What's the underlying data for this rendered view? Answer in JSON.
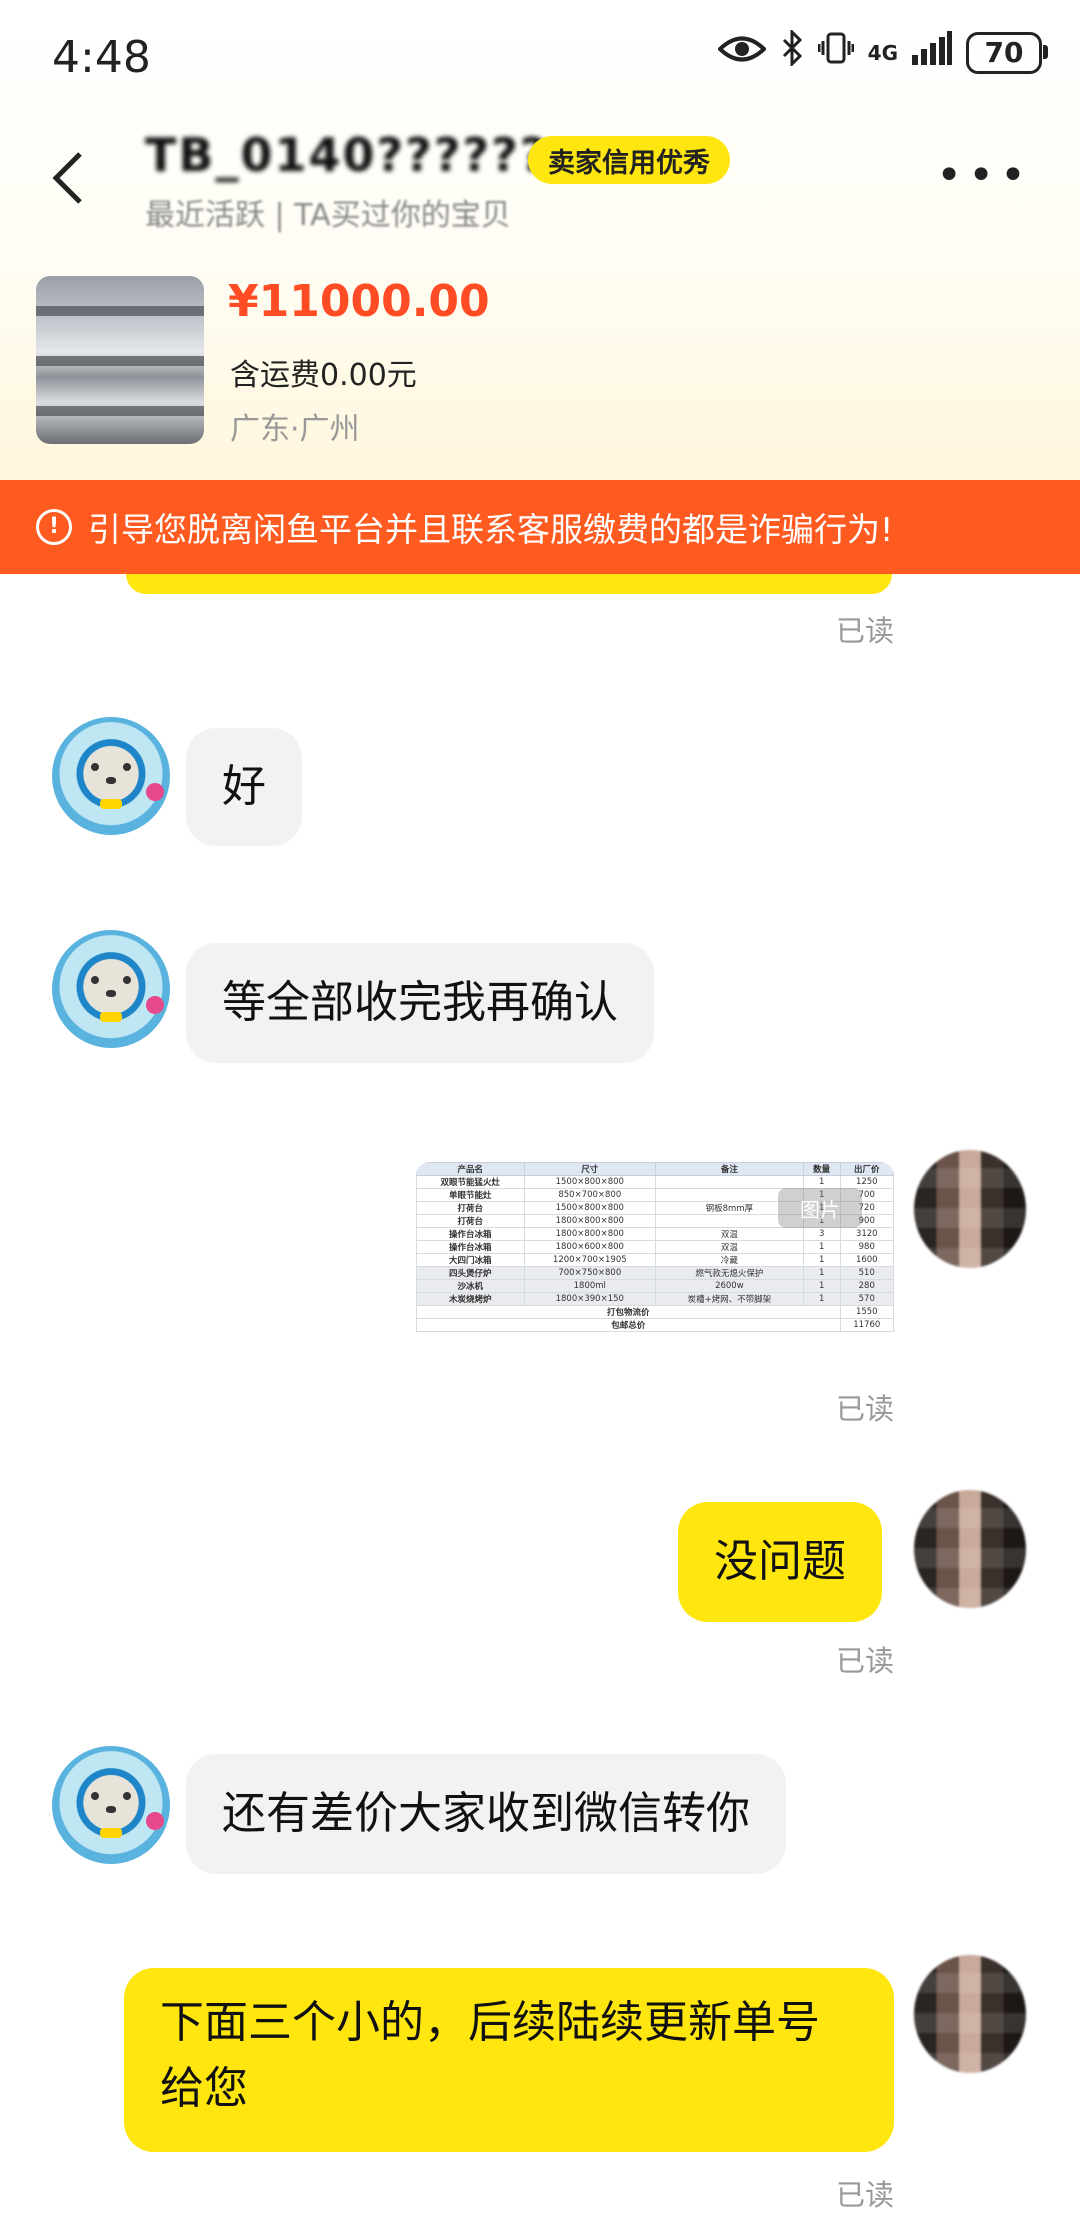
{
  "status_bar": {
    "time": "4:48",
    "network": "4G",
    "battery": "70"
  },
  "header": {
    "seller_name": "TB_0140??????",
    "badge": "卖家信用优秀",
    "subtitle": "最近活跃  |  TA买过你的宝贝"
  },
  "product": {
    "price": "¥11000.00",
    "shipping": "含运费0.00元",
    "location": "广东·广州"
  },
  "warning": {
    "text": "引导您脱离闲鱼平台并且联系客服缴费的都是诈骗行为!"
  },
  "messages": {
    "read_label": "已读",
    "m1": "好",
    "m2": "等全部收完我再确认",
    "m3": "没问题",
    "m4": "还有差价大家收到微信转你",
    "m5": "下面三个小的，后续陆续更新单号给您"
  },
  "sheet": {
    "image_tag": "图片",
    "headers": [
      "产品名",
      "尺寸",
      "备注",
      "数量",
      "出厂价"
    ],
    "rows": [
      [
        "双眼节能猛火灶",
        "1500×800×800",
        "",
        "1",
        "1250"
      ],
      [
        "单眼节能灶",
        "850×700×800",
        "",
        "1",
        "700"
      ],
      [
        "打荷台",
        "1500×800×800",
        "钢板8mm厚",
        "1",
        "720"
      ],
      [
        "打荷台",
        "1800×800×800",
        "",
        "1",
        "900"
      ],
      [
        "操作台冰箱",
        "1800×800×800",
        "双温",
        "3",
        "3120"
      ],
      [
        "操作台冰箱",
        "1800×600×800",
        "双温",
        "1",
        "980"
      ],
      [
        "大四门冰箱",
        "1200×700×1905",
        "冷藏",
        "1",
        "1600"
      ],
      [
        "四头煲仔炉",
        "700×750×800",
        "燃气款无熄火保护",
        "1",
        "510"
      ],
      [
        "沙冰机",
        "1800ml",
        "2600w",
        "1",
        "280"
      ],
      [
        "木炭烧烤炉",
        "1800×390×150",
        "炭槽+烤网、不带脚架",
        "1",
        "570"
      ]
    ],
    "footer": [
      {
        "label": "打包物流价",
        "value": "1550"
      },
      {
        "label": "包邮总价",
        "value": "11760"
      }
    ]
  }
}
